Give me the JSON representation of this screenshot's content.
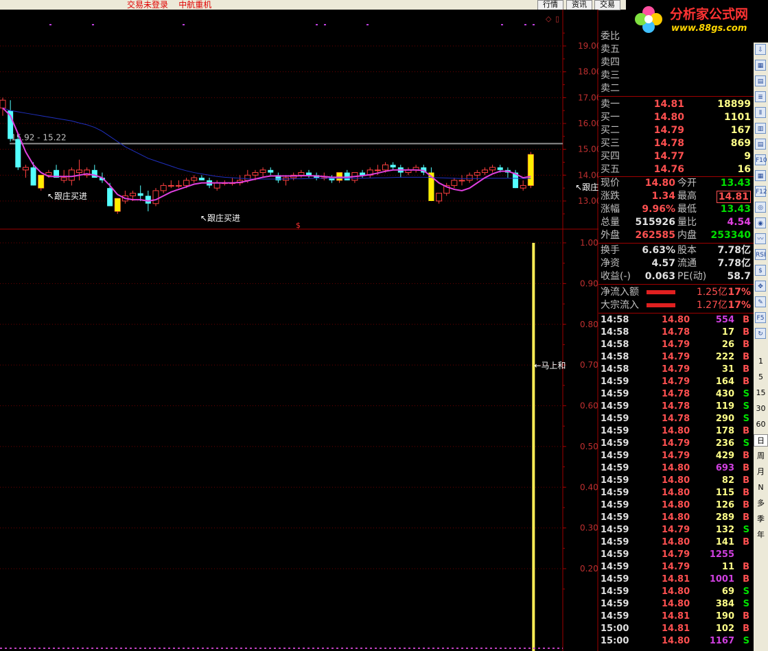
{
  "topbar": {
    "status_text": "交易未登录    中航重机",
    "buttons": [
      "行情",
      "资讯",
      "交易"
    ]
  },
  "logo": {
    "brand": "分析家公式网",
    "url": "www.88gs.com"
  },
  "chart_data": [
    {
      "type": "candlestick",
      "yticks": [
        "19.00",
        "18.00",
        "17.00",
        "16.00",
        "15.00",
        "14.00",
        "13.00"
      ],
      "ylim": [
        12.3,
        19.7
      ],
      "range_label": "15.92 - 15.22",
      "reference_line": 15.22,
      "annotations": [
        {
          "text": "↖跟庄买进",
          "x": 6,
          "y": 13.4
        },
        {
          "text": "↖跟庄买进",
          "x": 26,
          "y": 12.55
        },
        {
          "text": "↖跟庄买进",
          "x": 75,
          "y": 13.75
        },
        {
          "text": "↖跟庄买进",
          "x": 96,
          "y": 13.1
        },
        {
          "text": "↖跟庄买进",
          "x": 118,
          "y": 13.45
        }
      ],
      "candles": [
        [
          16.6,
          17.0,
          16.3,
          16.9
        ],
        [
          16.5,
          16.9,
          15.3,
          15.4
        ],
        [
          15.4,
          15.6,
          14.2,
          14.3
        ],
        [
          14.2,
          14.4,
          13.9,
          14.3
        ],
        [
          14.3,
          14.5,
          13.6,
          13.6
        ],
        [
          13.5,
          14.0,
          13.4,
          14.0
        ],
        [
          14.0,
          14.2,
          13.9,
          14.1
        ],
        [
          14.2,
          14.4,
          13.9,
          13.9
        ],
        [
          13.8,
          14.2,
          13.7,
          13.9
        ],
        [
          13.8,
          14.3,
          13.6,
          14.2
        ],
        [
          14.1,
          14.6,
          13.8,
          14.2
        ],
        [
          14.0,
          14.3,
          13.9,
          14.2
        ],
        [
          14.2,
          14.4,
          13.9,
          13.9
        ],
        [
          13.9,
          14.1,
          13.7,
          13.8
        ],
        [
          13.5,
          13.7,
          12.8,
          12.8
        ],
        [
          12.6,
          13.1,
          12.5,
          13.1
        ],
        [
          13.0,
          13.4,
          12.9,
          13.2
        ],
        [
          13.2,
          13.4,
          13.0,
          13.3
        ],
        [
          13.3,
          13.6,
          13.0,
          13.2
        ],
        [
          13.2,
          13.4,
          12.6,
          12.9
        ],
        [
          12.9,
          13.5,
          12.8,
          13.4
        ],
        [
          13.4,
          13.7,
          13.3,
          13.6
        ],
        [
          13.6,
          13.8,
          13.5,
          13.6
        ],
        [
          13.6,
          13.8,
          13.5,
          13.6
        ],
        [
          13.6,
          13.9,
          13.5,
          13.8
        ],
        [
          13.8,
          14.0,
          13.7,
          13.9
        ],
        [
          13.9,
          14.0,
          13.8,
          13.8
        ],
        [
          13.8,
          13.9,
          13.5,
          13.6
        ],
        [
          13.5,
          13.8,
          13.4,
          13.7
        ],
        [
          13.7,
          13.8,
          13.6,
          13.7
        ],
        [
          13.7,
          13.9,
          13.6,
          13.7
        ],
        [
          13.7,
          14.0,
          13.6,
          13.8
        ],
        [
          13.8,
          14.2,
          13.7,
          14.0
        ],
        [
          14.0,
          14.2,
          13.8,
          14.1
        ],
        [
          14.1,
          14.3,
          13.9,
          14.2
        ],
        [
          14.2,
          14.3,
          14.0,
          14.1
        ],
        [
          14.0,
          14.1,
          13.7,
          13.8
        ],
        [
          13.8,
          14.0,
          13.6,
          13.9
        ],
        [
          13.9,
          14.1,
          13.8,
          14.0
        ],
        [
          14.0,
          14.2,
          13.9,
          14.1
        ],
        [
          14.1,
          14.2,
          13.9,
          14.0
        ],
        [
          14.0,
          14.1,
          13.8,
          13.9
        ],
        [
          13.9,
          14.1,
          13.8,
          13.9
        ],
        [
          13.9,
          14.0,
          13.7,
          13.8
        ],
        [
          13.8,
          14.1,
          13.7,
          14.1
        ],
        [
          14.1,
          14.2,
          13.8,
          13.8
        ],
        [
          13.8,
          14.1,
          13.7,
          14.1
        ],
        [
          14.1,
          14.2,
          13.9,
          14.0
        ],
        [
          14.0,
          14.3,
          13.9,
          14.2
        ],
        [
          14.2,
          14.4,
          14.0,
          14.2
        ],
        [
          14.2,
          14.5,
          14.1,
          14.4
        ],
        [
          14.4,
          14.5,
          14.2,
          14.3
        ],
        [
          14.3,
          14.4,
          13.9,
          14.1
        ],
        [
          14.1,
          14.3,
          14.0,
          14.2
        ],
        [
          14.2,
          14.4,
          14.1,
          14.3
        ],
        [
          14.3,
          14.4,
          14.0,
          14.1
        ],
        [
          14.1,
          14.3,
          13.0,
          13.0
        ],
        [
          13.0,
          13.3,
          12.9,
          13.3
        ],
        [
          13.3,
          13.7,
          13.2,
          13.6
        ],
        [
          13.6,
          13.9,
          13.5,
          13.8
        ],
        [
          13.8,
          14.0,
          13.6,
          13.8
        ],
        [
          13.8,
          14.1,
          13.7,
          14.0
        ],
        [
          14.0,
          14.2,
          13.8,
          14.1
        ],
        [
          14.1,
          14.3,
          14.0,
          14.2
        ],
        [
          14.2,
          14.4,
          14.1,
          14.3
        ],
        [
          14.3,
          14.4,
          14.1,
          14.2
        ],
        [
          14.2,
          14.3,
          13.9,
          14.1
        ],
        [
          14.1,
          14.2,
          13.5,
          13.5
        ],
        [
          13.5,
          13.8,
          13.4,
          13.6
        ],
        [
          13.6,
          14.9,
          13.5,
          14.8
        ]
      ],
      "candle_x_start": 0,
      "candle_x_step": 11.15,
      "ma_fast": [
        16.6,
        16.3,
        15.6,
        14.9,
        14.4,
        14.1,
        13.95,
        13.95,
        13.95,
        13.95,
        14.0,
        14.05,
        14.0,
        13.9,
        13.6,
        13.25,
        13.1,
        13.05,
        13.05,
        13.0,
        13.05,
        13.2,
        13.35,
        13.45,
        13.55,
        13.65,
        13.7,
        13.7,
        13.7,
        13.7,
        13.7,
        13.72,
        13.78,
        13.85,
        13.92,
        13.97,
        13.97,
        13.97,
        13.97,
        13.98,
        13.98,
        13.97,
        13.95,
        13.92,
        13.92,
        13.92,
        13.95,
        13.98,
        14.02,
        14.08,
        14.15,
        14.2,
        14.2,
        14.2,
        14.2,
        14.18,
        13.95,
        13.7,
        13.55,
        13.45,
        13.4,
        13.5,
        13.7,
        13.9,
        14.05,
        14.15,
        14.15,
        14.05,
        13.9,
        13.95
      ],
      "ma_slow": [
        16.6,
        16.5,
        16.45,
        16.4,
        16.35,
        16.3,
        16.25,
        16.2,
        16.15,
        16.1,
        16.02,
        15.95,
        15.85,
        15.7,
        15.5,
        15.3,
        15.1,
        14.95,
        14.8,
        14.65,
        14.55,
        14.45,
        14.35,
        14.25,
        14.17,
        14.1,
        14.05,
        14.0,
        13.95,
        13.92,
        13.9,
        13.88,
        13.86,
        13.85,
        13.85,
        13.85,
        13.85,
        13.85,
        13.86,
        13.86,
        13.87,
        13.88,
        13.88,
        13.88,
        13.88,
        13.88,
        13.88,
        13.88,
        13.89,
        13.9,
        13.9,
        13.91,
        13.92,
        13.92,
        13.92,
        13.92,
        13.91,
        13.9,
        13.89,
        13.88,
        13.87,
        13.87,
        13.87,
        13.88,
        13.88,
        13.88,
        13.88,
        13.88,
        13.87,
        13.87
      ]
    },
    {
      "type": "bar",
      "yticks": [
        "1.00",
        "0.90",
        "0.80",
        "0.70",
        "0.60",
        "0.50",
        "0.40",
        "0.30",
        "0.20"
      ],
      "ylim": [
        0,
        1.0
      ],
      "signal_label": "←马上和",
      "signal_value": 1.0,
      "signal_position": 69
    }
  ],
  "quote": {
    "rows": [
      {
        "label": "委比",
        "v1": "",
        "v2": "",
        "c1": "red"
      },
      {
        "label": "卖五",
        "v1": "",
        "v2": ""
      },
      {
        "label": "卖四",
        "v1": "",
        "v2": ""
      },
      {
        "label": "卖三",
        "v1": "",
        "v2": ""
      },
      {
        "label": "卖二",
        "v1": "",
        "v2": ""
      },
      {
        "label": "卖一",
        "v1": "14.81",
        "v2": "18899"
      },
      {
        "label": "买一",
        "v1": "14.80",
        "v2": "1101"
      },
      {
        "label": "买二",
        "v1": "14.79",
        "v2": "167"
      },
      {
        "label": "买三",
        "v1": "14.78",
        "v2": "869"
      },
      {
        "label": "买四",
        "v1": "14.77",
        "v2": "9"
      },
      {
        "label": "买五",
        "v1": "14.76",
        "v2": "16"
      }
    ],
    "stats": [
      {
        "l1": "现价",
        "v1": "14.80",
        "c1": "red",
        "l2": "今开",
        "v2": "13.43",
        "c2": "green"
      },
      {
        "l1": "涨跌",
        "v1": "1.34",
        "c1": "red",
        "l2": "最高",
        "v2": "14.81",
        "c2": "red"
      },
      {
        "l1": "涨幅",
        "v1": "9.96%",
        "c1": "red",
        "l2": "最低",
        "v2": "13.43",
        "c2": "green"
      },
      {
        "l1": "总量",
        "v1": "515926",
        "c1": "white",
        "l2": "量比",
        "v2": "4.54",
        "c2": "magenta"
      },
      {
        "l1": "外盘",
        "v1": "262585",
        "c1": "red",
        "l2": "内盘",
        "v2": "253340",
        "c2": "green"
      }
    ],
    "stats2": [
      {
        "l1": "换手",
        "v1": "6.63%",
        "l2": "股本",
        "v2": "7.78亿"
      },
      {
        "l1": "净资",
        "v1": "4.57",
        "l2": "流通",
        "v2": "7.78亿"
      },
      {
        "l1": "收益(-)",
        "v1": "0.063",
        "l2": "PE(动)",
        "v2": "58.7"
      }
    ],
    "flows": [
      {
        "label": "净流入额",
        "amount": "1.25亿",
        "pct": "17%"
      },
      {
        "label": "大宗流入",
        "amount": "1.27亿",
        "pct": "17%"
      }
    ]
  },
  "ticks": [
    [
      "14:58",
      "14.80",
      "554",
      "B"
    ],
    [
      "14:58",
      "14.78",
      "17",
      "B"
    ],
    [
      "14:58",
      "14.79",
      "26",
      "B"
    ],
    [
      "14:58",
      "14.79",
      "222",
      "B"
    ],
    [
      "14:58",
      "14.79",
      "31",
      "B"
    ],
    [
      "14:59",
      "14.79",
      "164",
      "B"
    ],
    [
      "14:59",
      "14.78",
      "430",
      "S"
    ],
    [
      "14:59",
      "14.78",
      "119",
      "S"
    ],
    [
      "14:59",
      "14.78",
      "290",
      "S"
    ],
    [
      "14:59",
      "14.80",
      "178",
      "B"
    ],
    [
      "14:59",
      "14.79",
      "236",
      "S"
    ],
    [
      "14:59",
      "14.79",
      "429",
      "B"
    ],
    [
      "14:59",
      "14.80",
      "693",
      "B"
    ],
    [
      "14:59",
      "14.80",
      "82",
      "B"
    ],
    [
      "14:59",
      "14.80",
      "115",
      "B"
    ],
    [
      "14:59",
      "14.80",
      "126",
      "B"
    ],
    [
      "14:59",
      "14.80",
      "289",
      "B"
    ],
    [
      "14:59",
      "14.79",
      "132",
      "S"
    ],
    [
      "14:59",
      "14.80",
      "141",
      "B"
    ],
    [
      "14:59",
      "14.79",
      "1255",
      ""
    ],
    [
      "14:59",
      "14.79",
      "11",
      "B"
    ],
    [
      "14:59",
      "14.81",
      "1001",
      "B"
    ],
    [
      "14:59",
      "14.80",
      "69",
      "S"
    ],
    [
      "14:59",
      "14.80",
      "384",
      "S"
    ],
    [
      "14:59",
      "14.81",
      "190",
      "B"
    ],
    [
      "15:00",
      "14.81",
      "102",
      "B"
    ],
    [
      "15:00",
      "14.80",
      "1167",
      "S"
    ]
  ],
  "sidebar": {
    "icons": [
      "arrow-down-icon",
      "chart-icon",
      "table-icon",
      "list-icon",
      "candle-icon",
      "bars-icon",
      "doc-icon",
      "f10-icon",
      "grid-icon",
      "f12-icon",
      "compass-icon",
      "globe-icon",
      "line-icon",
      "rsi-icon",
      "stock-icon",
      "move-icon",
      "pen-icon",
      "f5-icon",
      "refresh-icon"
    ],
    "icon_glyphs": [
      "⇩",
      "▦",
      "▤",
      "≣",
      "⫴",
      "▥",
      "▤",
      "F10",
      "▦",
      "F12",
      "◎",
      "◉",
      "〰",
      "RSI",
      "$",
      "✥",
      "✎",
      "F5",
      "↻"
    ],
    "periods": [
      "1",
      "5",
      "15",
      "30",
      "60",
      "日",
      "周",
      "月",
      "N",
      "多",
      "季",
      "年"
    ],
    "selected_period": "日"
  }
}
